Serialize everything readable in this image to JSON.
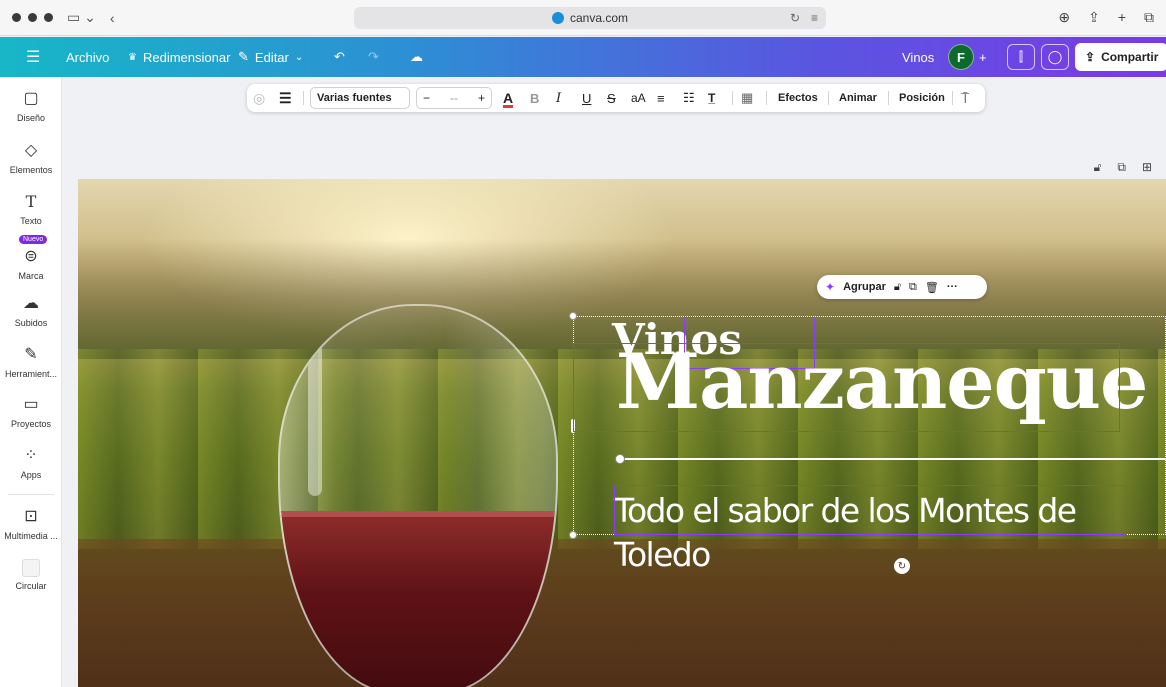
{
  "browser": {
    "url": "canva.com",
    "reload_icon": "reload-icon",
    "sidebar_toggle_icon": "sidebar-toggle-icon"
  },
  "topbar": {
    "file_label": "Archivo",
    "resize_label": "Redimensionar",
    "edit_label": "Editar",
    "document_title": "Vinos",
    "avatar_initial": "F",
    "share_label": "Compartir",
    "gradient_colors": [
      "#17b7c7",
      "#7a3ae6"
    ]
  },
  "sidebar": {
    "items": [
      {
        "label": "Diseño",
        "icon": "design-icon"
      },
      {
        "label": "Elementos",
        "icon": "elements-icon"
      },
      {
        "label": "Texto",
        "icon": "text-icon"
      },
      {
        "label": "Marca",
        "icon": "brand-icon",
        "badge": "Nuevo"
      },
      {
        "label": "Subidos",
        "icon": "upload-icon"
      },
      {
        "label": "Herramient...",
        "icon": "tools-icon"
      },
      {
        "label": "Proyectos",
        "icon": "folder-icon"
      },
      {
        "label": "Apps",
        "icon": "apps-icon"
      },
      {
        "label": "Multimedia ...",
        "icon": "media-icon"
      },
      {
        "label": "Circular",
        "icon": "circular-icon"
      }
    ]
  },
  "format_toolbar": {
    "font_name": "Varias fuentes",
    "font_size_placeholder": "--",
    "bold": "B",
    "italic": "I",
    "underline": "U",
    "strike": "S",
    "case": "aA",
    "effects_label": "Efectos",
    "animate_label": "Animar",
    "position_label": "Posición",
    "text_color": "#e53935"
  },
  "context_menu": {
    "group_label": "Agrupar"
  },
  "design": {
    "title_small": "Vinos",
    "title_large": "Manzaneque",
    "tagline": "Todo el sabor de los Montes de Toledo"
  },
  "colors": {
    "accent": "#8b3dff",
    "avatar": "#0c6b2c",
    "wine": "#5e1216"
  }
}
